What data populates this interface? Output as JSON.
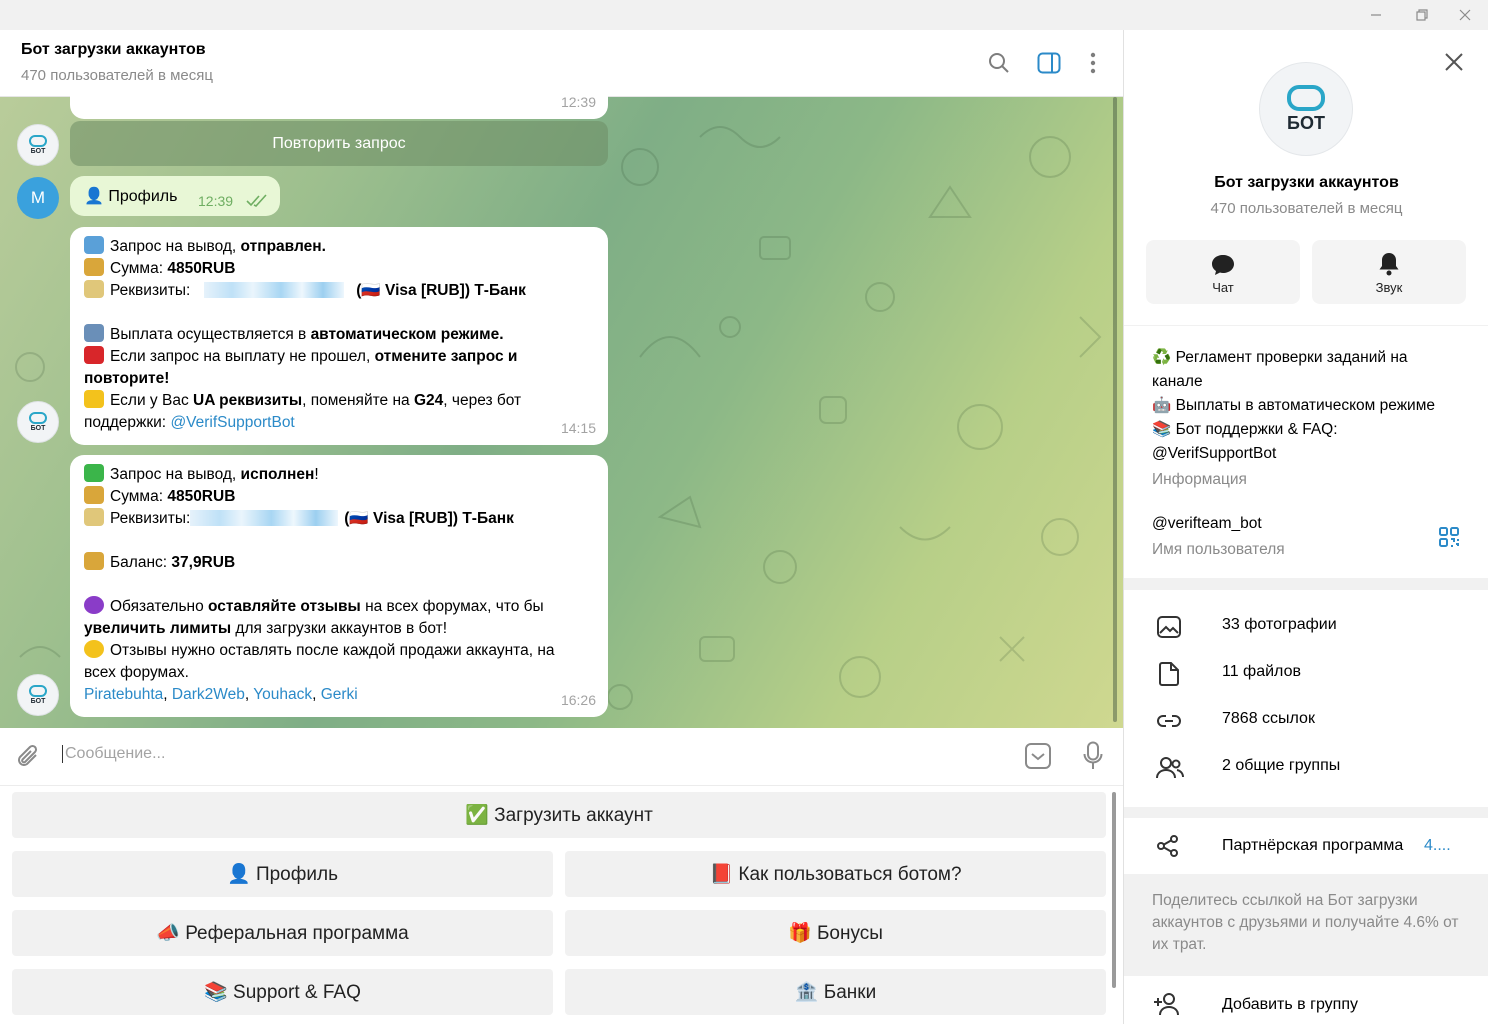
{
  "window": {
    "minimize_icon": "minimize-icon",
    "restore_icon": "restore-icon",
    "close_icon": "close-icon"
  },
  "header": {
    "title": "Бот загрузки аккаунтов",
    "subtitle": "470 пользователей в месяц"
  },
  "messages": {
    "first_time": "12:39",
    "repeat_button": "Повторить запрос",
    "user_avatar_letter": "M",
    "user_message": "👤 Профиль",
    "user_time": "12:39",
    "msg1": {
      "l1_a": "Запрос на вывод, ",
      "l1_b": "отправлен.",
      "l2_a": "Сумма: ",
      "l2_b": "4850RUB",
      "l3_a": "Реквизиты:",
      "l3_b": "(🇷🇺 Visa [RUB]) Т-Банк",
      "l4_a": "Выплата осуществляется в ",
      "l4_b": "автоматическом режиме.",
      "l5_a": "Если запрос на выплату не прошел, ",
      "l5_b": "отмените запрос и",
      "l6": "повторите!",
      "l7_a": "Если у Вас ",
      "l7_b": "UA реквизиты",
      "l7_c": ", поменяйте на ",
      "l7_d": "G24",
      "l7_e": ", через бот",
      "l8_a": "поддержки: ",
      "l8_b": "@VerifSupportBot",
      "time": "14:15"
    },
    "msg2": {
      "l1_a": "Запрос на вывод, ",
      "l1_b": "исполнен",
      "l1_c": "!",
      "l2_a": "Сумма: ",
      "l2_b": "4850RUB",
      "l3_a": "Реквизиты:",
      "l3_b": "(🇷🇺 Visa [RUB]) Т-Банк",
      "l4_a": "Баланс: ",
      "l4_b": "37,9RUB",
      "l5_a": "Обязательно ",
      "l5_b": "оставляйте отзывы",
      "l5_c": " на всех форумах, что бы",
      "l6_a": "увеличить лимиты",
      "l6_b": " для загрузки аккаунтов в бот!",
      "l7": "Отзывы нужно оставлять после каждой продажи аккаунта, на",
      "l8": "всех форумах.",
      "link1": "Piratebuhta",
      "link2": "Dark2Web",
      "link3": "Youhack",
      "link4": "Gerki",
      "sep": ", ",
      "time": "16:26"
    }
  },
  "input": {
    "placeholder": "Сообщение..."
  },
  "keyboard": {
    "upload": "✅ Загрузить аккаунт",
    "profile": "👤 Профиль",
    "howto": "📕 Как пользоваться ботом?",
    "referral": "📣 Реферальная программа",
    "bonuses": "🎁 Бонусы",
    "support": "📚 Support & FAQ",
    "banks": "🏦 Банки"
  },
  "right_panel": {
    "avatar_label": "БОТ",
    "name": "Бот загрузки аккаунтов",
    "subtitle": "470 пользователей в месяц",
    "chat_label": "Чат",
    "sound_label": "Звук",
    "info_line1": "♻️ Регламент проверки заданий на",
    "info_line2": "канале",
    "info_line3": "🤖 Выплаты в автоматическом режиме",
    "info_line4": "📚 Бот поддержки & FAQ:",
    "info_link": "@VerifSupportBot",
    "info_caption": "Информация",
    "username": "@verifteam_bot",
    "username_caption": "Имя пользователя",
    "photos": "33 фотографии",
    "files": "11 файлов",
    "links": "7868 ссылок",
    "groups": "2 общие группы",
    "partner": "Партнёрская программа",
    "partner_value": "4....",
    "partner_desc": "Поделитесь ссылкой на Бот загрузки аккаунтов с друзьями и получайте 4.6% от их трат.",
    "add_to_group": "Добавить в группу"
  }
}
